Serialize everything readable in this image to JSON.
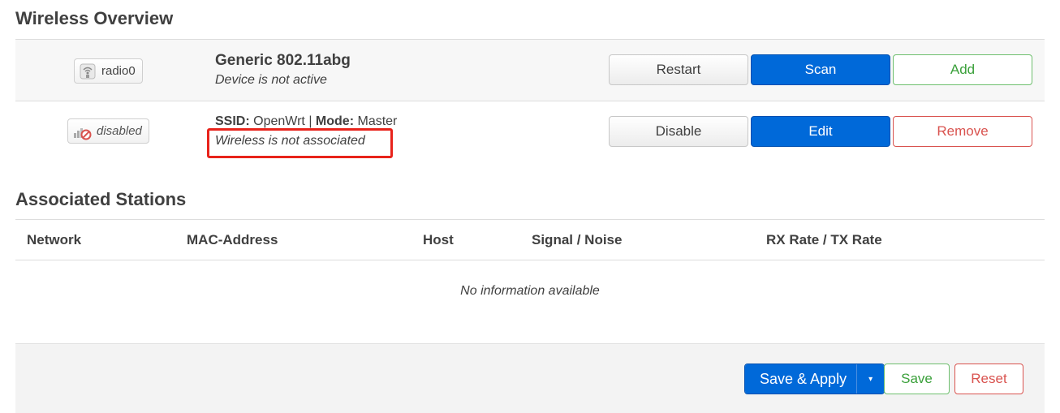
{
  "overview": {
    "title": "Wireless Overview",
    "radio": {
      "badge_label": "radio0",
      "name": "Generic 802.11abg",
      "status": "Device is not active",
      "buttons": {
        "restart": "Restart",
        "scan": "Scan",
        "add": "Add"
      }
    },
    "network": {
      "badge_label": "disabled",
      "ssid_label": "SSID:",
      "ssid_value": "OpenWrt",
      "separator": "|",
      "mode_label": "Mode:",
      "mode_value": "Master",
      "status": "Wireless is not associated",
      "buttons": {
        "disable": "Disable",
        "edit": "Edit",
        "remove": "Remove"
      }
    }
  },
  "stations": {
    "title": "Associated Stations",
    "columns": [
      "Network",
      "MAC-Address",
      "Host",
      "Signal / Noise",
      "RX Rate / TX Rate"
    ],
    "empty_message": "No information available"
  },
  "footer": {
    "save_apply": "Save & Apply",
    "dropdown_caret": "▾",
    "save": "Save",
    "reset": "Reset"
  },
  "colors": {
    "primary": "#0069d9",
    "positive": "#3aa03a",
    "negative": "#d9534f",
    "highlight": "#e8231b"
  },
  "icons": {
    "radio": "wifi-radio-icon",
    "disabled": "signal-disabled-icon"
  }
}
